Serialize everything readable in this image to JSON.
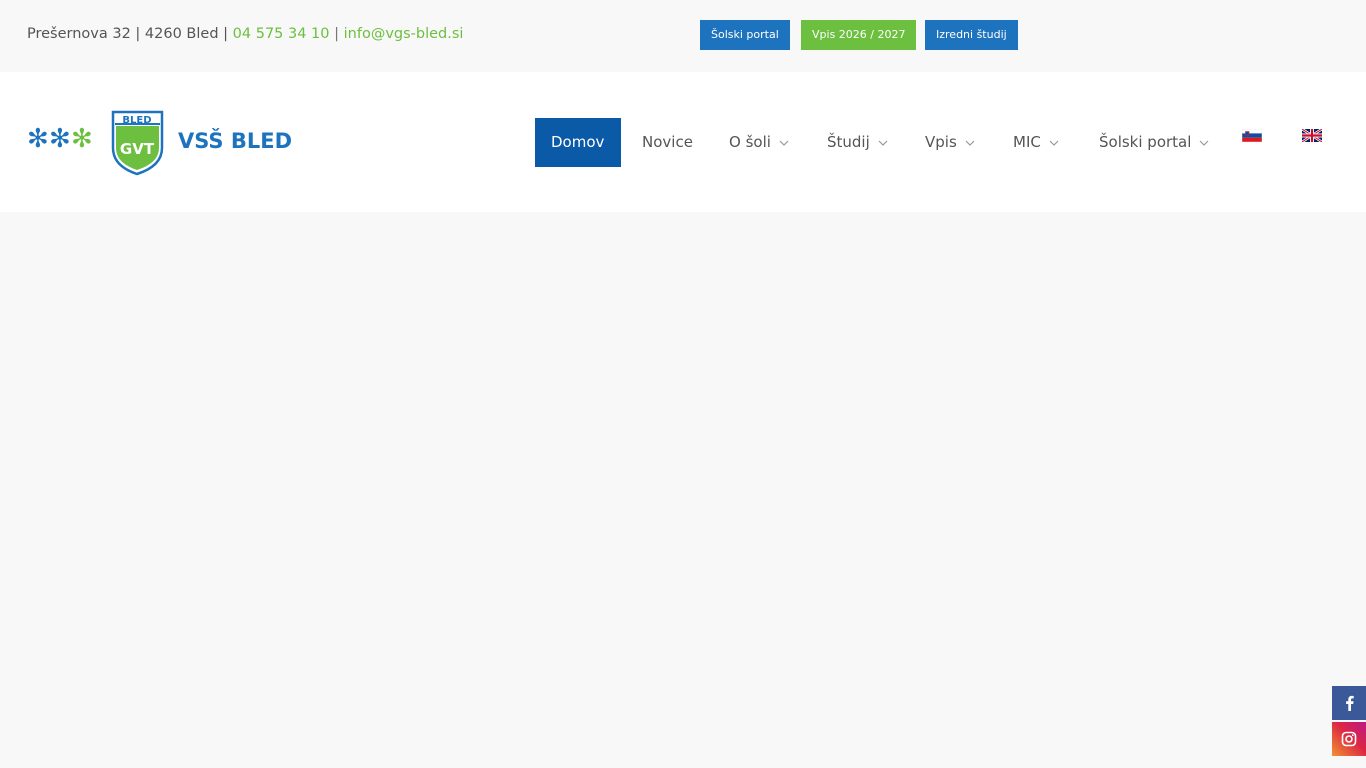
{
  "topbar": {
    "address": "Prešernova 32 | 4260 Bled | ",
    "phone": "04 575 34 10",
    "separator": " | ",
    "email": "info@vgs-bled.si",
    "buttons": [
      {
        "label": "Šolski portal",
        "color": "#1e73be"
      },
      {
        "label": "Vpis 2026 / 2027",
        "color": "#6cbf3f"
      },
      {
        "label": "Izredni študij",
        "color": "#1e73be"
      }
    ]
  },
  "logo": {
    "badge_top": "BLED",
    "badge_mid": "GVT",
    "text": "VSŠ BLED"
  },
  "nav": {
    "items": [
      {
        "label": "Domov",
        "active": true
      },
      {
        "label": "Novice"
      },
      {
        "label": "O šoli",
        "dropdown": true
      },
      {
        "label": "Študij",
        "dropdown": true
      },
      {
        "label": "Vpis",
        "dropdown": true
      },
      {
        "label": "MIC",
        "dropdown": true
      },
      {
        "label": "Šolski portal",
        "dropdown": true
      }
    ],
    "languages": [
      "slovenian-flag-icon",
      "uk-flag-icon"
    ]
  },
  "social": [
    "facebook-icon",
    "instagram-icon"
  ],
  "colors": {
    "accent_blue": "#0a5aa8",
    "brand_green": "#6cbf3f",
    "button_blue": "#1e73be"
  }
}
